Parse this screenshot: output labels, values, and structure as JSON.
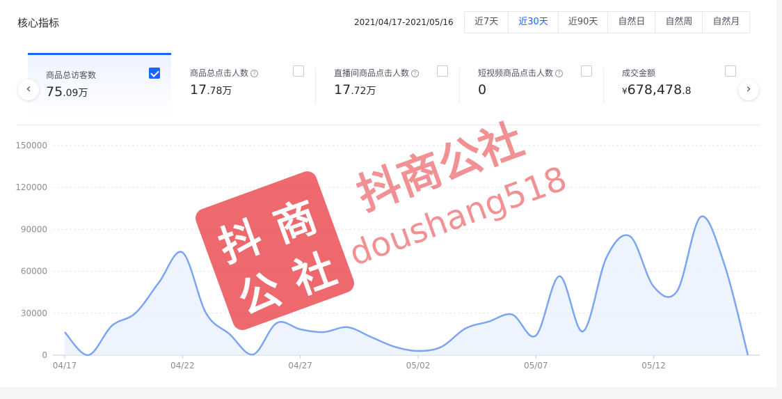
{
  "header": {
    "title": "核心指标",
    "date_range": "2021/04/17-2021/05/16",
    "tabs": [
      {
        "label": "近7天",
        "active": false
      },
      {
        "label": "近30天",
        "active": true
      },
      {
        "label": "近90天",
        "active": false
      },
      {
        "label": "自然日",
        "active": false
      },
      {
        "label": "自然周",
        "active": false
      },
      {
        "label": "自然月",
        "active": false
      }
    ]
  },
  "metrics": [
    {
      "label": "商品总访客数",
      "value_main": "75",
      "value_small": ".09万",
      "has_help": false,
      "checked": true
    },
    {
      "label": "商品总点击人数",
      "value_main": "17",
      "value_small": ".78万",
      "has_help": true,
      "checked": false
    },
    {
      "label": "直播间商品点击人数",
      "value_main": "17",
      "value_small": ".72万",
      "has_help": true,
      "checked": false
    },
    {
      "label": "短视频商品点击人数",
      "value_main": "0",
      "value_small": "",
      "has_help": true,
      "checked": false
    },
    {
      "label": "成交金额",
      "currency": "¥",
      "value_main": "678,478",
      "value_small": ".8",
      "has_help": false,
      "checked": false
    }
  ],
  "nav": {
    "prev_icon": "chevron-left-icon",
    "next_icon": "chevron-right-icon",
    "prev_glyph": "‹",
    "next_glyph": "›",
    "help_glyph": "?"
  },
  "watermark": {
    "brand": "抖商公社",
    "seal_chars": [
      "抖",
      "商",
      "公",
      "社"
    ],
    "handle": "doushang518",
    "color": "#e8383d"
  },
  "colors": {
    "accent": "#1966ff",
    "line": "#7ba4f2",
    "area": "#eaf1fd"
  },
  "chart_data": {
    "type": "area",
    "x": [
      "04/17",
      "04/18",
      "04/19",
      "04/20",
      "04/21",
      "04/22",
      "04/23",
      "04/24",
      "04/25",
      "04/26",
      "04/27",
      "04/28",
      "04/29",
      "04/30",
      "05/01",
      "05/02",
      "05/03",
      "05/04",
      "05/05",
      "05/06",
      "05/07",
      "05/08",
      "05/09",
      "05/10",
      "05/11",
      "05/12",
      "05/13",
      "05/14",
      "05/15",
      "05/16"
    ],
    "x_tick_labels": [
      "04/17",
      "04/22",
      "04/27",
      "05/02",
      "05/07",
      "05/12"
    ],
    "series": [
      {
        "values": [
          16500,
          0,
          21000,
          30000,
          52000,
          73500,
          30000,
          15000,
          500,
          23000,
          18500,
          16500,
          20000,
          13000,
          6000,
          3000,
          6000,
          19000,
          24000,
          29000,
          14000,
          56500,
          17000,
          70000,
          85000,
          49000,
          46000,
          99000,
          65000,
          0
        ]
      }
    ],
    "ylim": [
      0,
      150000
    ],
    "y_ticks": [
      "0",
      "30000",
      "60000",
      "90000",
      "120000",
      "150000"
    ],
    "grid": true,
    "title": "",
    "xlabel": "",
    "ylabel": ""
  }
}
